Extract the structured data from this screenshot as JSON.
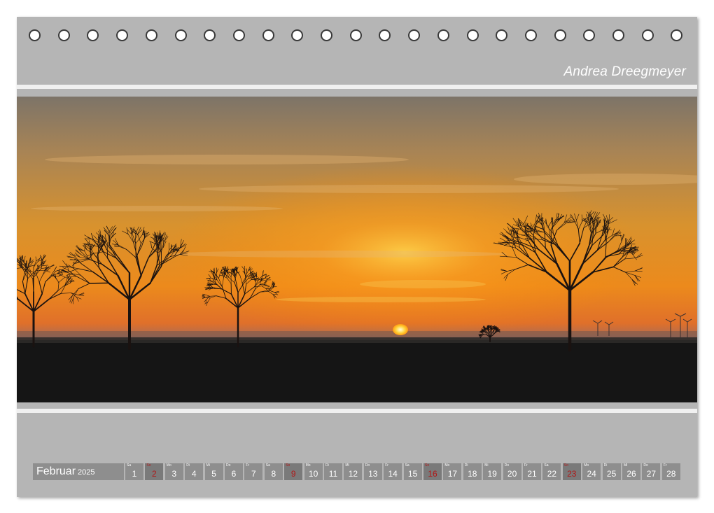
{
  "author": "Andrea Dreegmeyer",
  "calendar": {
    "month": "Februar",
    "year": "2025",
    "days": [
      {
        "dn": "Sa",
        "d": "1",
        "sunday": false
      },
      {
        "dn": "So",
        "d": "2",
        "sunday": true
      },
      {
        "dn": "Mo",
        "d": "3",
        "sunday": false
      },
      {
        "dn": "Di",
        "d": "4",
        "sunday": false
      },
      {
        "dn": "Mi",
        "d": "5",
        "sunday": false
      },
      {
        "dn": "Do",
        "d": "6",
        "sunday": false
      },
      {
        "dn": "Fr",
        "d": "7",
        "sunday": false
      },
      {
        "dn": "Sa",
        "d": "8",
        "sunday": false
      },
      {
        "dn": "So",
        "d": "9",
        "sunday": true
      },
      {
        "dn": "Mo",
        "d": "10",
        "sunday": false
      },
      {
        "dn": "Di",
        "d": "11",
        "sunday": false
      },
      {
        "dn": "Mi",
        "d": "12",
        "sunday": false
      },
      {
        "dn": "Do",
        "d": "13",
        "sunday": false
      },
      {
        "dn": "Fr",
        "d": "14",
        "sunday": false
      },
      {
        "dn": "Sa",
        "d": "15",
        "sunday": false
      },
      {
        "dn": "So",
        "d": "16",
        "sunday": true
      },
      {
        "dn": "Mo",
        "d": "17",
        "sunday": false
      },
      {
        "dn": "Di",
        "d": "18",
        "sunday": false
      },
      {
        "dn": "Mi",
        "d": "19",
        "sunday": false
      },
      {
        "dn": "Do",
        "d": "20",
        "sunday": false
      },
      {
        "dn": "Fr",
        "d": "21",
        "sunday": false
      },
      {
        "dn": "Sa",
        "d": "22",
        "sunday": false
      },
      {
        "dn": "So",
        "d": "23",
        "sunday": true
      },
      {
        "dn": "Mo",
        "d": "24",
        "sunday": false
      },
      {
        "dn": "Di",
        "d": "25",
        "sunday": false
      },
      {
        "dn": "Mi",
        "d": "26",
        "sunday": false
      },
      {
        "dn": "Do",
        "d": "27",
        "sunday": false
      },
      {
        "dn": "Fr",
        "d": "28",
        "sunday": false
      }
    ]
  },
  "colors": {
    "page": "#b5b5b5",
    "cell": "#8e8e8e",
    "sunday_text": "#b01818"
  }
}
